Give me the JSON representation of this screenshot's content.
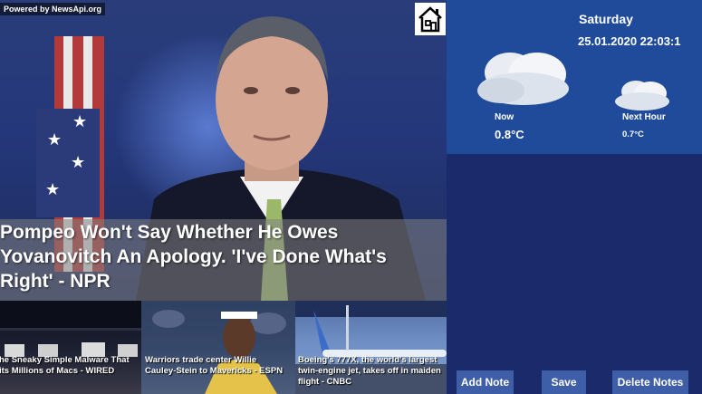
{
  "news": {
    "powered_by": "Powered by NewsApi.org",
    "headline": "Pompeo Won't Say Whether He Owes\nYovanovitch An Apology. 'I've Done What's\nRight' - NPR",
    "tiles": [
      {
        "caption": "he Sneaky Simple Malware That\nits Millions of Macs - WIRED"
      },
      {
        "caption": "Warriors trade center Willie\nCauley-Stein to Mavericks - ESPN"
      },
      {
        "caption": "Boeing's 777X, the world's largest\ntwin-engine jet, takes off in maiden\nflight - CNBC"
      }
    ]
  },
  "weather": {
    "day": "Saturday",
    "datetime": "25.01.2020 22:03:1",
    "now_label": "Now",
    "now_temp": "0.8°C",
    "next_label": "Next Hour",
    "next_temp": "0.7°C"
  },
  "buttons": {
    "add_note": "Add Note",
    "save": "Save",
    "delete_notes": "Delete Notes"
  },
  "icons": {
    "home": "home-icon",
    "cloud": "cloud-icon"
  },
  "colors": {
    "weather_panel": "#1f4b9a",
    "side_panel": "#1a2a6b",
    "button": "#3f5ea8"
  }
}
